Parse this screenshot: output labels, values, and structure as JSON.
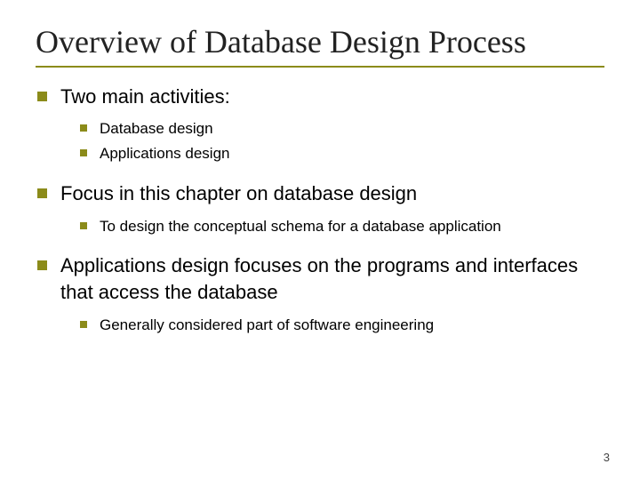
{
  "title": "Overview of Database Design Process",
  "bullets": [
    {
      "text": "Two main activities:",
      "sub": [
        {
          "text": "Database design"
        },
        {
          "text": "Applications design"
        }
      ]
    },
    {
      "text": "Focus in this chapter on database design",
      "sub": [
        {
          "text": "To design the conceptual schema for a database application"
        }
      ]
    },
    {
      "text": "Applications design focuses on the programs and interfaces that access the database",
      "sub": [
        {
          "text": "Generally considered part of software engineering"
        }
      ]
    }
  ],
  "page_number": "3"
}
